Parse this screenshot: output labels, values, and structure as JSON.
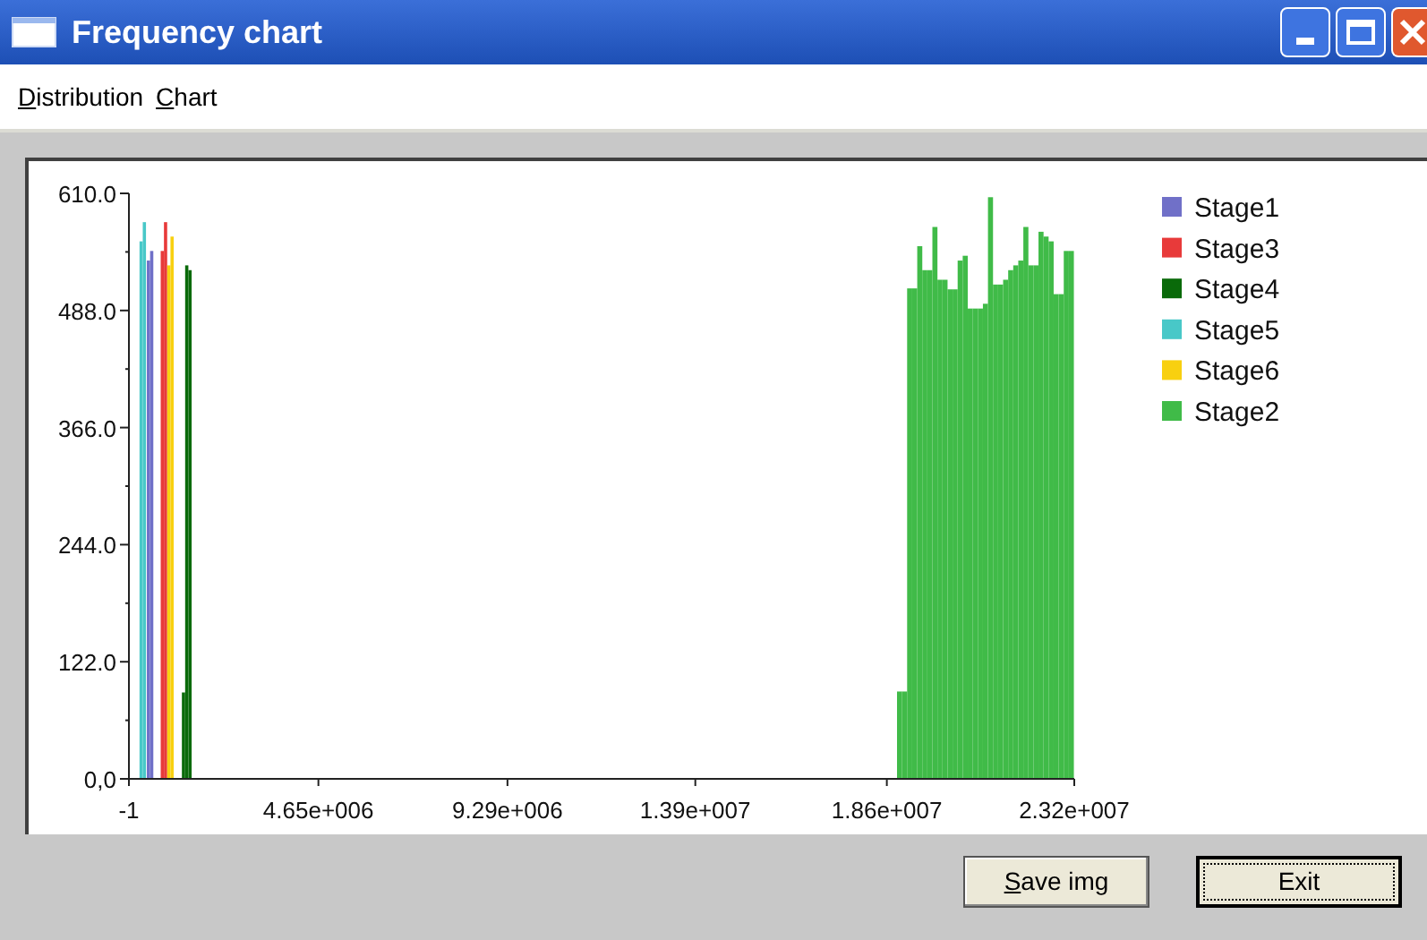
{
  "window": {
    "title": "Frequency chart"
  },
  "menu": [
    "Distribution",
    "Chart"
  ],
  "chart_data": {
    "type": "bar",
    "legend": true,
    "x": [
      260000,
      340000,
      440000,
      520000,
      780000,
      860000,
      940000,
      1020000,
      1300000,
      1380000,
      1460000,
      18850000,
      18974000,
      19098000,
      19222000,
      19346000,
      19470000,
      19594000,
      19718000,
      19842000,
      19966000,
      20090000,
      20214000,
      20338000,
      20462000,
      20586000,
      20710000,
      20834000,
      20958000,
      21082000,
      21206000,
      21330000,
      21454000,
      21578000,
      21702000,
      21826000,
      21950000,
      22074000,
      22198000,
      22322000,
      22446000,
      22570000,
      22694000,
      22818000,
      22942000,
      23066000
    ],
    "series": [
      {
        "name": "Stage1",
        "color": "#7070c8",
        "values": [
          null,
          null,
          540,
          550,
          null,
          null,
          null,
          null,
          null,
          null,
          null,
          null,
          null,
          null,
          null,
          null,
          null,
          null,
          null,
          null,
          null,
          null,
          null,
          null,
          null,
          null,
          null,
          null,
          null,
          null,
          null,
          null,
          null,
          null,
          null,
          null,
          null,
          null,
          null,
          null,
          null,
          null,
          null,
          null,
          null,
          null
        ]
      },
      {
        "name": "Stage3",
        "color": "#e83a3a",
        "values": [
          null,
          null,
          null,
          null,
          550,
          580,
          null,
          null,
          null,
          null,
          null,
          null,
          null,
          null,
          null,
          null,
          null,
          null,
          null,
          null,
          null,
          null,
          null,
          null,
          null,
          null,
          null,
          null,
          null,
          null,
          null,
          null,
          null,
          null,
          null,
          null,
          null,
          null,
          null,
          null,
          null,
          null,
          null,
          null,
          null,
          null
        ]
      },
      {
        "name": "Stage4",
        "color": "#0a6a0a",
        "values": [
          null,
          null,
          null,
          null,
          null,
          null,
          null,
          null,
          90,
          535,
          530,
          null,
          null,
          null,
          null,
          null,
          null,
          null,
          null,
          null,
          null,
          null,
          null,
          null,
          null,
          null,
          null,
          null,
          null,
          null,
          null,
          null,
          null,
          null,
          null,
          null,
          null,
          null,
          null,
          null,
          null,
          null,
          null,
          null,
          null,
          null
        ]
      },
      {
        "name": "Stage5",
        "color": "#48c8c8",
        "values": [
          560,
          580,
          null,
          null,
          null,
          null,
          null,
          null,
          null,
          null,
          null,
          null,
          null,
          null,
          null,
          null,
          null,
          null,
          null,
          null,
          null,
          null,
          null,
          null,
          null,
          null,
          null,
          null,
          null,
          null,
          null,
          null,
          null,
          null,
          null,
          null,
          null,
          null,
          null,
          null,
          null,
          null,
          null,
          null,
          null,
          null
        ]
      },
      {
        "name": "Stage6",
        "color": "#f8d010",
        "values": [
          null,
          null,
          null,
          null,
          null,
          null,
          535,
          565,
          null,
          null,
          null,
          null,
          null,
          null,
          null,
          null,
          null,
          null,
          null,
          null,
          null,
          null,
          null,
          null,
          null,
          null,
          null,
          null,
          null,
          null,
          null,
          null,
          null,
          null,
          null,
          null,
          null,
          null,
          null,
          null,
          null,
          null,
          null,
          null,
          null,
          null
        ]
      },
      {
        "name": "Stage2",
        "color": "#40bb48",
        "values": [
          null,
          null,
          null,
          null,
          null,
          null,
          null,
          null,
          null,
          null,
          null,
          91,
          91,
          511,
          511,
          555,
          530,
          530,
          575,
          520,
          520,
          510,
          510,
          540,
          545,
          490,
          490,
          490,
          495,
          606,
          515,
          515,
          520,
          530,
          535,
          540,
          575,
          535,
          535,
          570,
          565,
          560,
          505,
          505,
          550,
          550
        ]
      }
    ],
    "xlim": [
      -1,
      23200000
    ],
    "ylim": [
      0,
      610
    ],
    "xticks": [
      {
        "value": -1,
        "label": "-1"
      },
      {
        "value": 4650000,
        "label": "4.65e+006"
      },
      {
        "value": 9290000,
        "label": "9.29e+006"
      },
      {
        "value": 13900000,
        "label": "1.39e+007"
      },
      {
        "value": 18600000,
        "label": "1.86e+007"
      },
      {
        "value": 23200000,
        "label": "2.32e+007"
      }
    ],
    "yticks": [
      {
        "value": 0,
        "label": "0,0"
      },
      {
        "value": 122,
        "label": "122.0"
      },
      {
        "value": 244,
        "label": "244.0"
      },
      {
        "value": 366,
        "label": "366.0"
      },
      {
        "value": 488,
        "label": "488.0"
      },
      {
        "value": 610,
        "label": "610.0"
      }
    ]
  },
  "buttons": [
    {
      "label": "Save img",
      "selected": false
    },
    {
      "label": "Exit",
      "selected": true
    }
  ]
}
